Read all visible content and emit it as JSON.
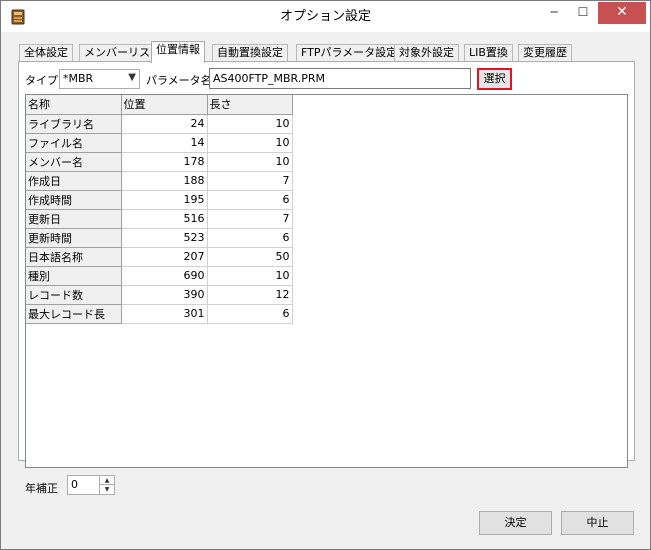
{
  "window": {
    "title": "オプション設定",
    "controls": {
      "minimize": "─",
      "maximize": "☐",
      "close": "✕"
    }
  },
  "tabs": [
    {
      "label": "全体設定",
      "active": false
    },
    {
      "label": "メンバーリスト",
      "active": false
    },
    {
      "label": "位置情報",
      "active": true
    },
    {
      "label": "自動置換設定",
      "active": false
    },
    {
      "label": "FTPパラメータ設定",
      "active": false
    },
    {
      "label": "対象外設定",
      "active": false
    },
    {
      "label": "LIB置換",
      "active": false
    },
    {
      "label": "変更履歴",
      "active": false
    }
  ],
  "form": {
    "type_label": "タイプ",
    "type_value": "*MBR",
    "param_label": "パラメータ名",
    "param_value": "AS400FTP_MBR.PRM",
    "select_button": "選択"
  },
  "grid": {
    "columns": [
      "名称",
      "位置",
      "長さ"
    ],
    "rows": [
      {
        "name": "ライブラリ名",
        "position": "24",
        "length": "10"
      },
      {
        "name": "ファイル名",
        "position": "14",
        "length": "10"
      },
      {
        "name": "メンバー名",
        "position": "178",
        "length": "10"
      },
      {
        "name": "作成日",
        "position": "188",
        "length": "7"
      },
      {
        "name": "作成時間",
        "position": "195",
        "length": "6"
      },
      {
        "name": "更新日",
        "position": "516",
        "length": "7"
      },
      {
        "name": "更新時間",
        "position": "523",
        "length": "6"
      },
      {
        "name": "日本語名称",
        "position": "207",
        "length": "50"
      },
      {
        "name": "種別",
        "position": "690",
        "length": "10"
      },
      {
        "name": "レコード数",
        "position": "390",
        "length": "12"
      },
      {
        "name": "最大レコード長",
        "position": "301",
        "length": "6"
      }
    ]
  },
  "year_correction": {
    "label": "年補正",
    "value": "0"
  },
  "buttons": {
    "ok": "決定",
    "cancel": "中止"
  },
  "colors": {
    "highlight_border": "#e81123",
    "close_button": "#c75050"
  }
}
